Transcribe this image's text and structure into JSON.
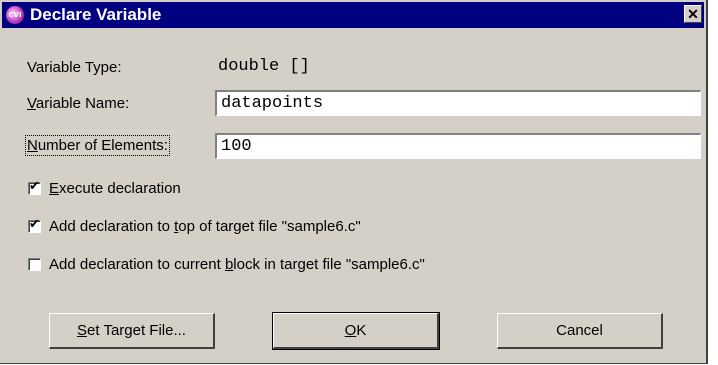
{
  "window": {
    "title": "Declare Variable",
    "app_icon": "cvi-app-icon",
    "close_glyph": "✕"
  },
  "fields": {
    "variable_type_label": "Variable Type:",
    "variable_type_value": "double []",
    "variable_name_label_u": "V",
    "variable_name_label_rest": "ariable Name:",
    "variable_name_value": "datapoints",
    "num_elements_label_u": "N",
    "num_elements_label_rest": "umber of Elements:",
    "num_elements_value": "100"
  },
  "options": [
    {
      "checked": true,
      "pre": "",
      "u": "E",
      "post": "xecute declaration"
    },
    {
      "checked": true,
      "pre": "Add declaration to ",
      "u": "t",
      "post": "op of target file \"sample6.c\""
    },
    {
      "checked": false,
      "pre": "Add declaration to current ",
      "u": "b",
      "post": "lock in target file \"sample6.c\""
    }
  ],
  "buttons": {
    "set_target_u": "S",
    "set_target_rest": "et Target File...",
    "ok_u": "O",
    "ok_rest": "K",
    "cancel": "Cancel"
  }
}
